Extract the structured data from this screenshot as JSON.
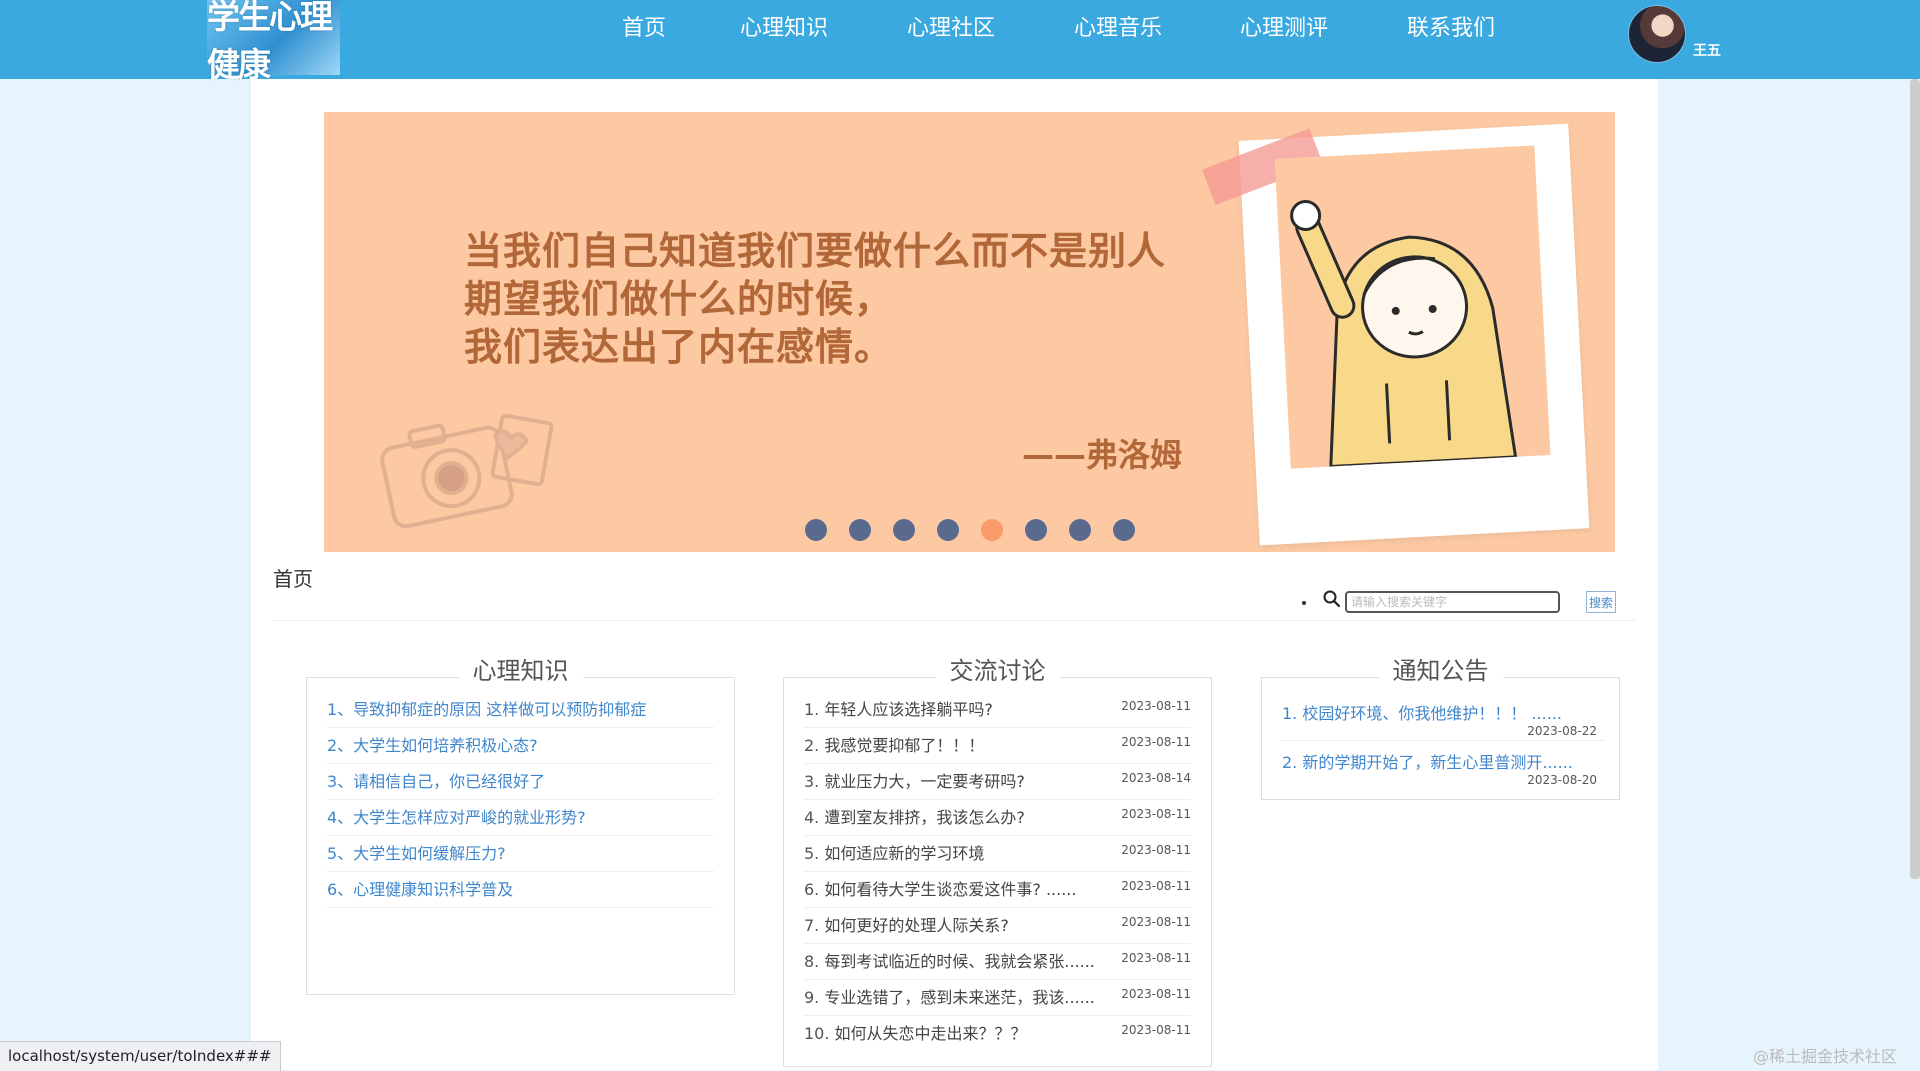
{
  "logo_text": "学生心理健康",
  "nav": [
    {
      "label": "首页"
    },
    {
      "label": "心理知识"
    },
    {
      "label": "心理社区"
    },
    {
      "label": "心理音乐"
    },
    {
      "label": "心理测评"
    },
    {
      "label": "联系我们"
    }
  ],
  "user": {
    "name": "王五"
  },
  "banner": {
    "quote_lines": [
      "当我们自己知道我们要做什么而不是别人",
      "期望我们做什么的时候，",
      "我们表达出了内在感情。"
    ],
    "author": "——弗洛姆",
    "slide_count": 8,
    "active_index": 4
  },
  "breadcrumb": "首页",
  "search": {
    "placeholder": "请输入搜索关键字",
    "button": "搜索"
  },
  "knowledge": {
    "title": "心理知识",
    "items": [
      "1、导致抑郁症的原因 这样做可以预防抑郁症",
      "2、大学生如何培养积极心态?",
      "3、请相信自己，你已经很好了",
      "4、大学生怎样应对严峻的就业形势?",
      "5、大学生如何缓解压力?",
      "6、心理健康知识科学普及"
    ]
  },
  "discussion": {
    "title": "交流讨论",
    "items": [
      {
        "num": "1.",
        "text": "年轻人应该选择躺平吗?",
        "date": "2023-08-11"
      },
      {
        "num": "2.",
        "text": "我感觉要抑郁了！！！",
        "date": "2023-08-11"
      },
      {
        "num": "3.",
        "text": "就业压力大，一定要考研吗?",
        "date": "2023-08-14"
      },
      {
        "num": "4.",
        "text": "遭到室友排挤，我该怎么办?",
        "date": "2023-08-11"
      },
      {
        "num": "5.",
        "text": "如何适应新的学习环境",
        "date": "2023-08-11"
      },
      {
        "num": "6.",
        "text": "如何看待大学生谈恋爱这件事?  ......",
        "date": "2023-08-11"
      },
      {
        "num": "7.",
        "text": "如何更好的处理人际关系?",
        "date": "2023-08-11"
      },
      {
        "num": "8.",
        "text": "每到考试临近的时候、我就会紧张......",
        "date": "2023-08-11"
      },
      {
        "num": "9.",
        "text": "专业选错了，感到未来迷茫，我该......",
        "date": "2023-08-11"
      },
      {
        "num": "10.",
        "text": " 如何从失恋中走出来？？？",
        "date": "2023-08-11"
      }
    ]
  },
  "notice": {
    "title": "通知公告",
    "items": [
      {
        "text": "1. 校园好环境、你我他维护！！！  ......",
        "date": "2023-08-22"
      },
      {
        "text": "2. 新的学期开始了，新生心里普测开......",
        "date": "2023-08-20"
      }
    ]
  },
  "status_url": "localhost/system/user/toIndex###",
  "watermark": "@稀土掘金技术社区",
  "colors": {
    "header": "#3aa9e0",
    "banner": "#fcc9a2",
    "dot": "#5a6a8e",
    "dot_active": "#f99a6a",
    "link": "#3f86cc"
  }
}
